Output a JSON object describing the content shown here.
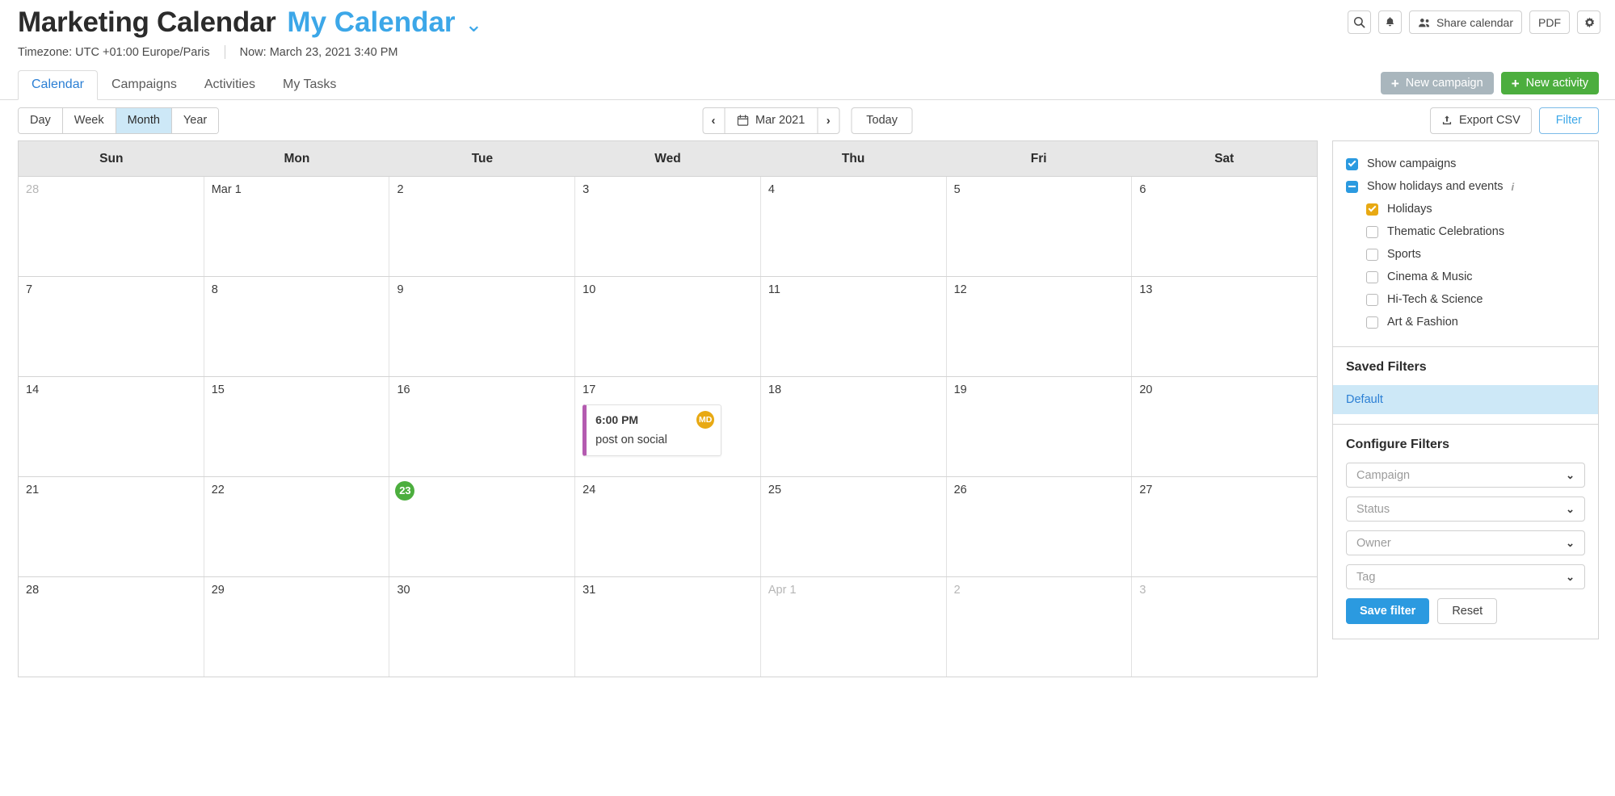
{
  "header": {
    "app_title": "Marketing Calendar",
    "calendar_name": "My Calendar",
    "caret": "⌄",
    "timezone": "Timezone: UTC +01:00 Europe/Paris",
    "now": "Now: March 23, 2021 3:40 PM",
    "actions": {
      "search_icon": "search-icon",
      "bell_icon": "bell-icon",
      "share_label": "Share calendar",
      "share_icon": "people-icon",
      "pdf_label": "PDF",
      "settings_icon": "gear-icon"
    }
  },
  "tabs": {
    "items": [
      {
        "label": "Calendar",
        "active": true
      },
      {
        "label": "Campaigns",
        "active": false
      },
      {
        "label": "Activities",
        "active": false
      },
      {
        "label": "My Tasks",
        "active": false
      }
    ],
    "new_campaign_label": "New campaign",
    "new_activity_label": "New activity",
    "plus": "+"
  },
  "toolbar": {
    "views": [
      {
        "label": "Day",
        "active": false
      },
      {
        "label": "Week",
        "active": false
      },
      {
        "label": "Month",
        "active": true
      },
      {
        "label": "Year",
        "active": false
      }
    ],
    "prev": "‹",
    "next": "›",
    "period_label": "Mar 2021",
    "calendar_icon": "calendar-icon",
    "today_label": "Today",
    "export_label": "Export CSV",
    "export_icon": "upload-icon",
    "filter_label": "Filter"
  },
  "calendar": {
    "day_headers": [
      "Sun",
      "Mon",
      "Tue",
      "Wed",
      "Thu",
      "Fri",
      "Sat"
    ],
    "weeks": [
      [
        {
          "label": "28",
          "muted": true
        },
        {
          "label": "Mar 1",
          "muted": false
        },
        {
          "label": "2",
          "muted": false
        },
        {
          "label": "3",
          "muted": false
        },
        {
          "label": "4",
          "muted": false
        },
        {
          "label": "5",
          "muted": false
        },
        {
          "label": "6",
          "muted": false
        }
      ],
      [
        {
          "label": "7",
          "muted": false
        },
        {
          "label": "8",
          "muted": false
        },
        {
          "label": "9",
          "muted": false
        },
        {
          "label": "10",
          "muted": false
        },
        {
          "label": "11",
          "muted": false
        },
        {
          "label": "12",
          "muted": false
        },
        {
          "label": "13",
          "muted": false
        }
      ],
      [
        {
          "label": "14",
          "muted": false
        },
        {
          "label": "15",
          "muted": false
        },
        {
          "label": "16",
          "muted": false
        },
        {
          "label": "17",
          "muted": false,
          "event": {
            "time": "6:00 PM",
            "title": "post on social",
            "avatar": "MD",
            "accent": "#b45bb0",
            "avatar_color": "#e8a913"
          }
        },
        {
          "label": "18",
          "muted": false
        },
        {
          "label": "19",
          "muted": false
        },
        {
          "label": "20",
          "muted": false
        }
      ],
      [
        {
          "label": "21",
          "muted": false
        },
        {
          "label": "22",
          "muted": false
        },
        {
          "label": "23",
          "muted": false,
          "today": true
        },
        {
          "label": "24",
          "muted": false
        },
        {
          "label": "25",
          "muted": false
        },
        {
          "label": "26",
          "muted": false
        },
        {
          "label": "27",
          "muted": false
        }
      ],
      [
        {
          "label": "28",
          "muted": false
        },
        {
          "label": "29",
          "muted": false
        },
        {
          "label": "30",
          "muted": false
        },
        {
          "label": "31",
          "muted": false
        },
        {
          "label": "Apr 1",
          "muted": true
        },
        {
          "label": "2",
          "muted": true
        },
        {
          "label": "3",
          "muted": true
        }
      ]
    ],
    "today_color": "#4cae3e"
  },
  "sidebar": {
    "checkboxes": [
      {
        "label": "Show campaigns",
        "state": "checked-blue",
        "indent": false,
        "info": false
      },
      {
        "label": "Show holidays and events",
        "state": "indet",
        "indent": false,
        "info": true
      },
      {
        "label": "Holidays",
        "state": "checked-orange",
        "indent": true,
        "info": false
      },
      {
        "label": "Thematic Celebrations",
        "state": "unchecked",
        "indent": true,
        "info": false
      },
      {
        "label": "Sports",
        "state": "unchecked",
        "indent": true,
        "info": false
      },
      {
        "label": "Cinema & Music",
        "state": "unchecked",
        "indent": true,
        "info": false
      },
      {
        "label": "Hi-Tech & Science",
        "state": "unchecked",
        "indent": true,
        "info": false
      },
      {
        "label": "Art & Fashion",
        "state": "unchecked",
        "indent": true,
        "info": false
      }
    ],
    "saved_filters_title": "Saved Filters",
    "saved_filters": [
      {
        "label": "Default",
        "selected": true
      }
    ],
    "configure_title": "Configure Filters",
    "selects": [
      {
        "placeholder": "Campaign"
      },
      {
        "placeholder": "Status"
      },
      {
        "placeholder": "Owner"
      },
      {
        "placeholder": "Tag"
      }
    ],
    "save_label": "Save filter",
    "reset_label": "Reset",
    "caret": "⌄",
    "info_glyph": "i"
  }
}
